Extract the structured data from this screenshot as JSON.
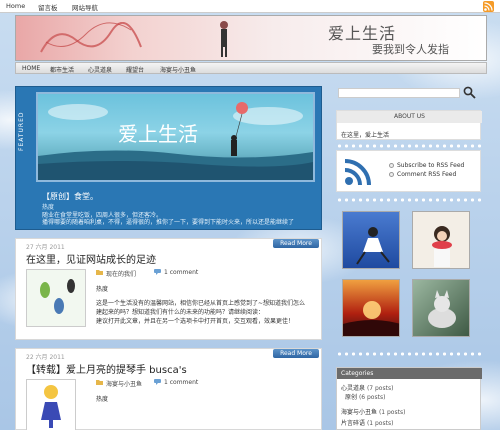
{
  "topbar": {
    "links": [
      "Home",
      "留言板",
      "网站导航"
    ],
    "rss_icon": "rss-icon"
  },
  "banner": {
    "title": "爱上生活",
    "subtitle": "要我到令人发指"
  },
  "nav": {
    "items": [
      "HOME",
      "都市生活",
      "心灵道泉",
      "耀望台",
      "海宴与小丑鱼"
    ]
  },
  "featured": {
    "label": "FEATURED",
    "image_title": "爱上生活",
    "title": "【原创】食堂。",
    "meta": "热度",
    "excerpt_line1": "随业在食堂里吃饭，四周人很多，但还客冷。",
    "excerpt_line2": "播得哪要的随着咱利桌，不得，逼得很的，推你了一下，要得到下能时火来，所以还是能继续了"
  },
  "posts": [
    {
      "date": "27 六月 2011",
      "title": "在这里，见证网站成长的足迹",
      "more_label": "Read More",
      "category": "现在的我们",
      "comments": "1 comment",
      "meta": "热度",
      "excerpt_line1": "这是一个生活没有的温馨网站，相信你已经从首页上感觉到了~想知道我们怎么",
      "excerpt_line2": "建起来的吗？想知道我们有什么的未来的功能吗？请继续阅读：",
      "excerpt_line3": "建议打开此文章，并且在另一个选项卡中打开首页，交互观看，效果更佳！"
    },
    {
      "date": "22 六月 2011",
      "title": "【转载】爱上月亮的提琴手 busca's",
      "more_label": "Read More",
      "category": "海宴与小丑鱼",
      "comments": "1 comment",
      "meta": "热度"
    }
  ],
  "sidebar": {
    "search_placeholder": "",
    "about_title": "ABOUT US",
    "about_text": "在这里，爱上生活",
    "rss_links": [
      "Subscribe to RSS Feed",
      "Comment RSS Feed"
    ],
    "categories_title": "Categories",
    "categories": [
      {
        "name": "心灵道泉",
        "count": "(7 posts)"
      },
      {
        "name": "原创",
        "count": "(6 posts)"
      },
      {
        "name": "海宴与小丑鱼",
        "count": "(1 posts)"
      },
      {
        "name": "片言碎语",
        "count": "(1 posts)"
      }
    ]
  },
  "colors": {
    "accent": "#2a77b4",
    "button": "#3a72ad",
    "rss": "#f59b28",
    "featured_bg": "#2a77b4"
  }
}
